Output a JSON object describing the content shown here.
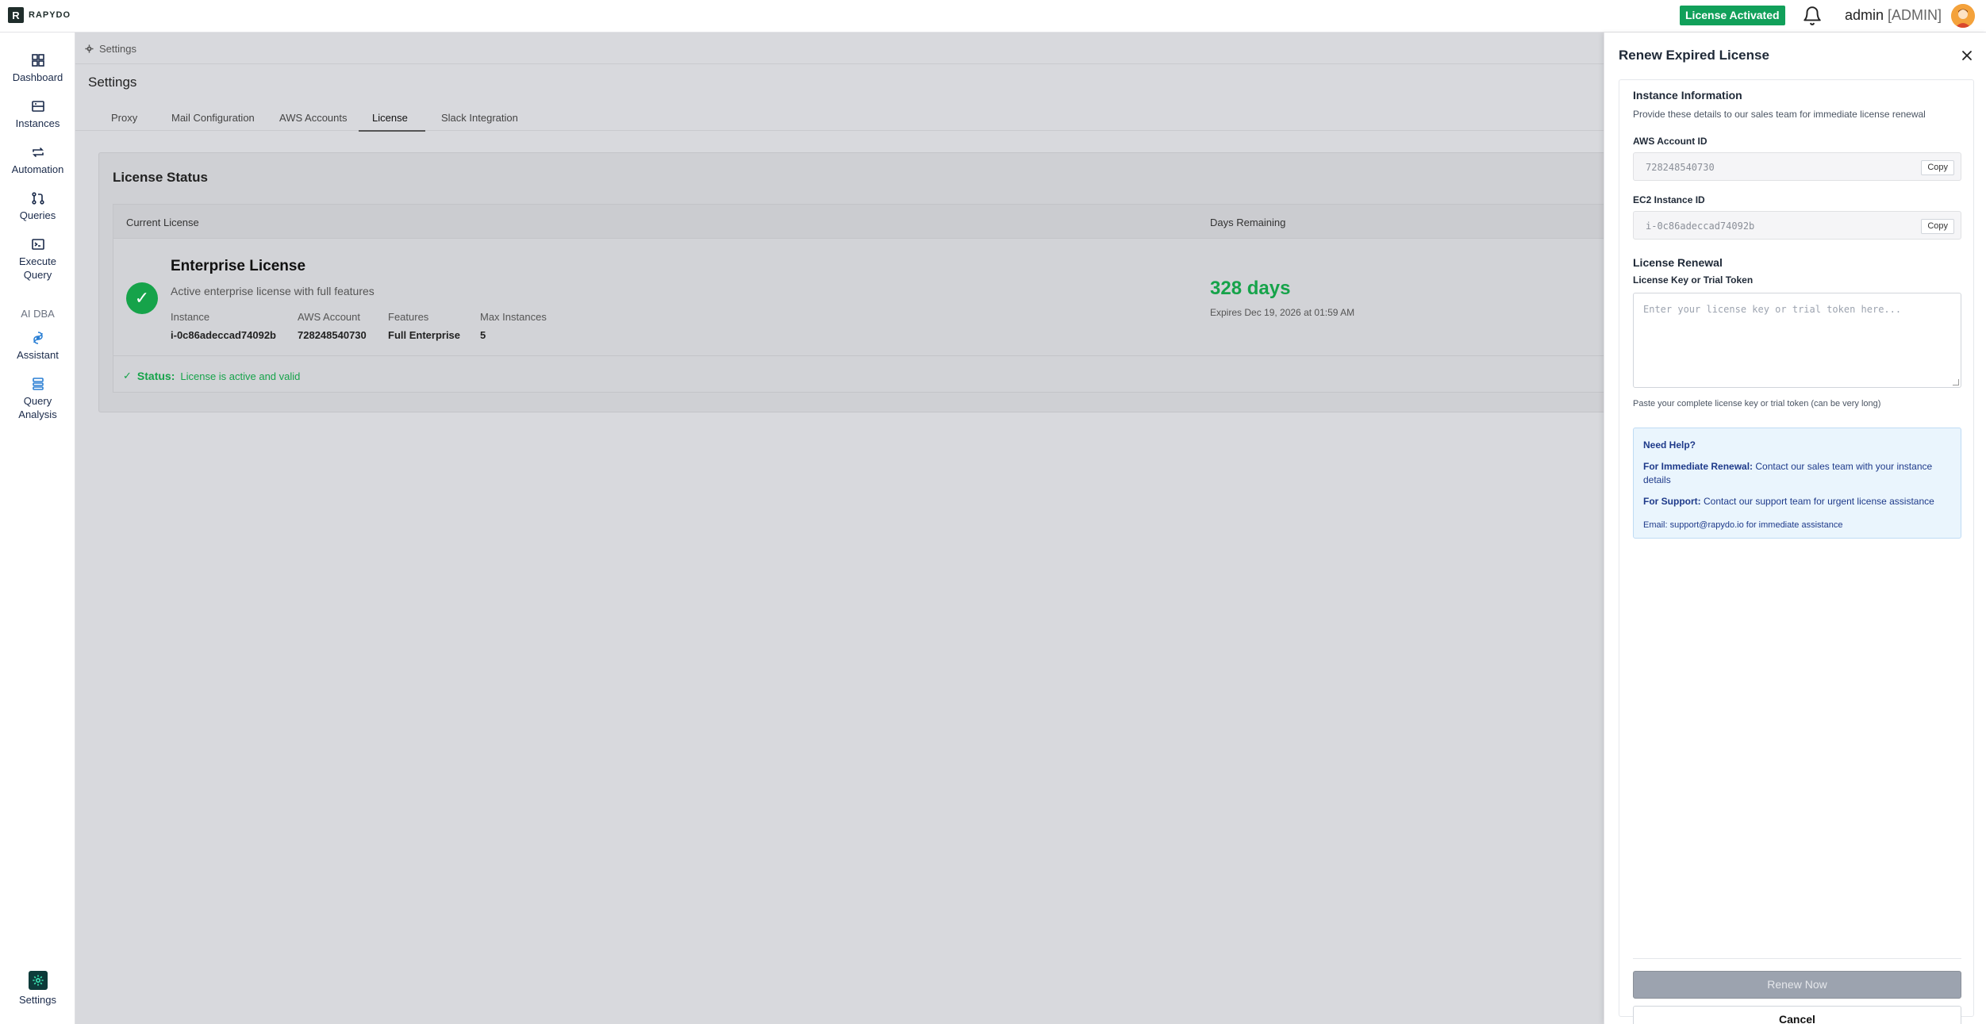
{
  "brand": {
    "logo_letter": "R",
    "name": "RAPYDO"
  },
  "topbar": {
    "license_badge": "License Activated",
    "user_name": "admin",
    "user_role": "[ADMIN]"
  },
  "sidebar": {
    "items": [
      {
        "label": "Dashboard",
        "icon": "dashboard-icon"
      },
      {
        "label": "Instances",
        "icon": "server-icon"
      },
      {
        "label": "Automation",
        "icon": "repeat-icon"
      },
      {
        "label": "Queries",
        "icon": "pull-request-icon"
      },
      {
        "label": "Execute Query",
        "icon": "terminal-icon"
      }
    ],
    "section_label": "AI DBA",
    "ai_items": [
      {
        "label": "Assistant",
        "icon": "assistant-icon"
      },
      {
        "label": "Query Analysis",
        "icon": "query-analysis-icon"
      }
    ],
    "settings_label": "Settings"
  },
  "breadcrumb": {
    "label": "Settings"
  },
  "page": {
    "title": "Settings"
  },
  "tabs": [
    {
      "label": "Proxy"
    },
    {
      "label": "Mail Configuration"
    },
    {
      "label": "AWS Accounts"
    },
    {
      "label": "License",
      "active": true
    },
    {
      "label": "Slack Integration"
    }
  ],
  "license_status": {
    "title": "License Status",
    "col_current": "Current License",
    "col_days": "Days Remaining",
    "name": "Enterprise License",
    "description": "Active enterprise license with full features",
    "meta": [
      {
        "label": "Instance",
        "value": "i-0c86adeccad74092b"
      },
      {
        "label": "AWS Account",
        "value": "728248540730"
      },
      {
        "label": "Features",
        "value": "Full Enterprise"
      },
      {
        "label": "Max Instances",
        "value": "5"
      }
    ],
    "days": "328 days",
    "expires": "Expires Dec 19, 2026 at 01:59 AM",
    "status_label": "Status:",
    "status_text": "License is active and valid",
    "status_color": "#16a34a"
  },
  "drawer": {
    "title": "Renew Expired License",
    "instance_info_title": "Instance Information",
    "instance_info_sub": "Provide these details to our sales team for immediate license renewal",
    "aws_label": "AWS Account ID",
    "aws_value": "728248540730",
    "ec2_label": "EC2 Instance ID",
    "ec2_value": "i-0c86adeccad74092b",
    "copy_label": "Copy",
    "renewal_title": "License Renewal",
    "key_label": "License Key or Trial Token",
    "key_placeholder": "Enter your license key or trial token here...",
    "key_hint": "Paste your complete license key or trial token (can be very long)",
    "help": {
      "title": "Need Help?",
      "renewal_bold": "For Immediate Renewal:",
      "renewal_text": "Contact our sales team with your instance details",
      "support_bold": "For Support:",
      "support_text": "Contact our support team for urgent license assistance",
      "email_line": "Email: support@rapydo.io for immediate assistance"
    },
    "renew_button": "Renew Now",
    "cancel_button": "Cancel"
  },
  "colors": {
    "accent_green": "#11a05a",
    "success": "#16a34a",
    "help_bg": "#eaf5fd"
  }
}
